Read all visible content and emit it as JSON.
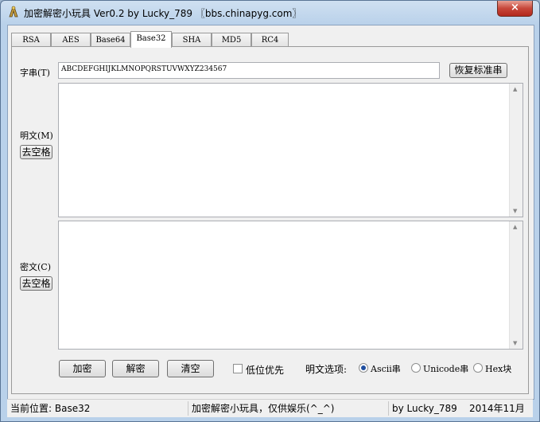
{
  "window": {
    "title": "加密解密小玩具 Ver0.2 by Lucky_789 〖bbs.chinapyg.com〗",
    "close_glyph": "×"
  },
  "tabs": [
    {
      "label": "RSA",
      "active": false
    },
    {
      "label": "AES",
      "active": false
    },
    {
      "label": "Base64",
      "active": false
    },
    {
      "label": "Base32",
      "active": true
    },
    {
      "label": "SHA",
      "active": false
    },
    {
      "label": "MD5",
      "active": false
    },
    {
      "label": "RC4",
      "active": false
    }
  ],
  "charset": {
    "label": "字串(T)",
    "value": "ABCDEFGHIJKLMNOPQRSTUVWXYZ234567",
    "restore_button": "恢复标准串"
  },
  "plaintext": {
    "label": "明文(M)",
    "strip_button": "去空格",
    "value": ""
  },
  "ciphertext": {
    "label": "密文(C)",
    "strip_button": "去空格",
    "value": ""
  },
  "actions": {
    "encrypt": "加密",
    "decrypt": "解密",
    "clear": "清空",
    "low_bit_first": "低位优先",
    "low_bit_first_checked": false
  },
  "plain_options": {
    "label": "明文选项:",
    "options": [
      {
        "label": "Ascii串",
        "selected": true
      },
      {
        "label": "Unicode串",
        "selected": false
      },
      {
        "label": "Hex块",
        "selected": false
      }
    ]
  },
  "status": {
    "location": "当前位置: Base32",
    "message": "加密解密小玩具，仅供娱乐(^_^)",
    "author_date": "by Lucky_789    2014年11月"
  }
}
